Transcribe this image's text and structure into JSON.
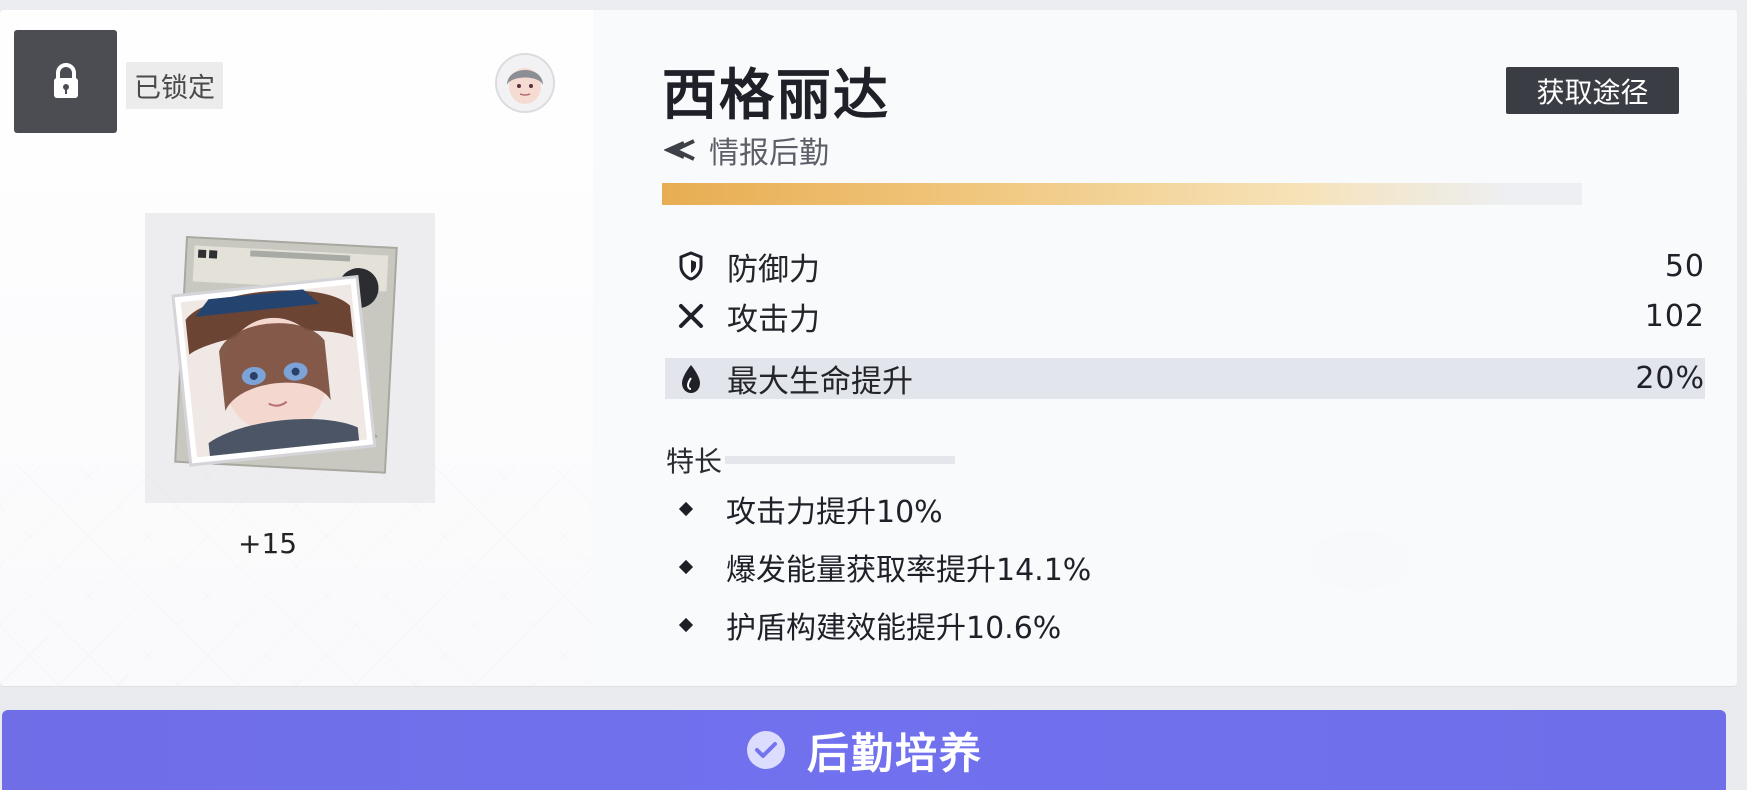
{
  "card": {
    "lock_label": "已锁定",
    "plus_level": "+15",
    "title": "西格丽达",
    "get_path_label": "获取途径",
    "subtitle": "情报后勤",
    "progress_fraction": 0.92
  },
  "stats": [
    {
      "label": "防御力",
      "value": "50",
      "icon": "shield-icon"
    },
    {
      "label": "攻击力",
      "value": "102",
      "icon": "crossed-swords-icon"
    },
    {
      "label": "最大生命提升",
      "value": "20%",
      "icon": "drop-icon"
    }
  ],
  "specialty": {
    "title": "特长",
    "items": [
      "攻击力提升10%",
      "爆发能量获取率提升14.1%",
      "护盾构建效能提升10.6%"
    ]
  },
  "action": {
    "label": "后勤培养",
    "icon": "check-circle-icon"
  },
  "colors": {
    "accent": "#7070ED",
    "progress_gold": "#E7AD52",
    "dark_button": "#3B3D45"
  }
}
